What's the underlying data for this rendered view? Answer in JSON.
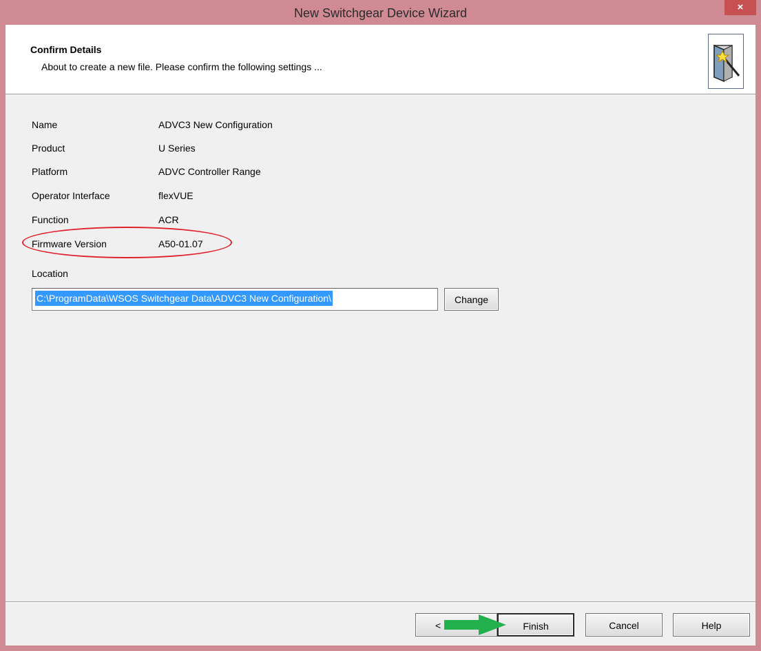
{
  "window": {
    "title": "New Switchgear Device Wizard",
    "close_label": "×"
  },
  "header": {
    "title": "Confirm Details",
    "subtitle": "About to create a new file. Please confirm the following settings ..."
  },
  "details": [
    {
      "label": "Name",
      "value": "ADVC3 New Configuration"
    },
    {
      "label": "Product",
      "value": "U Series"
    },
    {
      "label": "Platform",
      "value": "ADVC Controller Range"
    },
    {
      "label": "Operator Interface",
      "value": "flexVUE"
    },
    {
      "label": "Function",
      "value": "ACR"
    },
    {
      "label": "Firmware Version",
      "value": "A50-01.07"
    }
  ],
  "location": {
    "label": "Location",
    "value": "C:\\ProgramData\\WSOS Switchgear Data\\ADVC3 New Configuration\\",
    "change_label": "Change"
  },
  "buttons": {
    "back_label": "<",
    "finish_label": "Finish",
    "cancel_label": "Cancel",
    "help_label": "Help"
  },
  "colors": {
    "title_bar": "#cf8a94",
    "close_button": "#c75050",
    "highlight_ellipse": "#e0202a",
    "arrow": "#22b14c",
    "selection": "#3399ff"
  },
  "icons": {
    "wizard": "wizard-door-wand-icon",
    "annotation_arrow": "green-arrow-icon"
  }
}
